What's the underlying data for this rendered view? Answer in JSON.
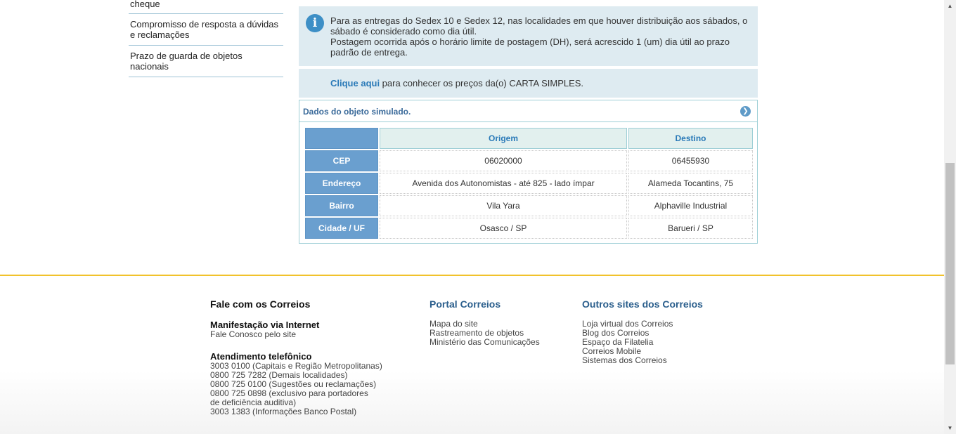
{
  "sidebar": {
    "items": [
      {
        "label": "cheque"
      },
      {
        "label": "Compromisso de resposta a dúvidas e reclamações"
      },
      {
        "label": "Prazo de guarda de objetos nacionais"
      }
    ]
  },
  "info": {
    "line1": "Para as entregas do Sedex 10 e Sedex 12, nas localidades em que houver distribuição aos sábados, o sábado é considerado como dia útil.",
    "line2": "Postagem ocorrida após o horário limite de postagem (DH), será acrescido 1 (um) dia útil ao prazo padrão de entrega.",
    "icon": "info-icon"
  },
  "prices_link": {
    "link_text": "Clique aqui",
    "rest_text": " para conhecer os preços da(o) CARTA SIMPLES."
  },
  "simulated": {
    "title": "Dados do objeto simulado.",
    "columns": [
      "Origem",
      "Destino"
    ],
    "rows": [
      {
        "label": "CEP",
        "origem": "06020000",
        "destino": "06455930"
      },
      {
        "label": "Endereço",
        "origem": "Avenida dos Autonomistas - até 825 - lado ímpar",
        "destino": "Alameda Tocantins, 75"
      },
      {
        "label": "Bairro",
        "origem": "Vila Yara",
        "destino": "Alphaville Industrial"
      },
      {
        "label": "Cidade / UF",
        "origem": "Osasco / SP",
        "destino": "Barueri / SP"
      }
    ]
  },
  "footer": {
    "col1": {
      "title": "Fale com os Correios",
      "internet_title": "Manifestação via Internet",
      "internet_link": "Fale Conosco pelo site",
      "phone_title": "Atendimento telefônico",
      "phones": [
        "3003 0100 (Capitais e Região Metropolitanas)",
        "0800 725 7282 (Demais localidades)",
        "0800 725 0100 (Sugestões ou reclamações)",
        "0800 725 0898 (exclusivo para portadores",
        "de deficiência auditiva)",
        "3003 1383 (Informações Banco Postal)"
      ]
    },
    "col2": {
      "title": "Portal Correios",
      "links": [
        "Mapa do site",
        "Rastreamento de objetos",
        "Ministério das Comunicações"
      ]
    },
    "col3": {
      "title": "Outros sites dos Correios",
      "links": [
        "Loja virtual dos Correios",
        "Blog dos Correios",
        "Espaço da Filatelia",
        "Correios Mobile",
        "Sistemas dos Correios"
      ]
    }
  },
  "colors": {
    "accent_blue": "#2a7ab8",
    "info_bg": "#deebf1",
    "header_blue": "#6a9fcf",
    "footer_border": "#f1c22c"
  }
}
